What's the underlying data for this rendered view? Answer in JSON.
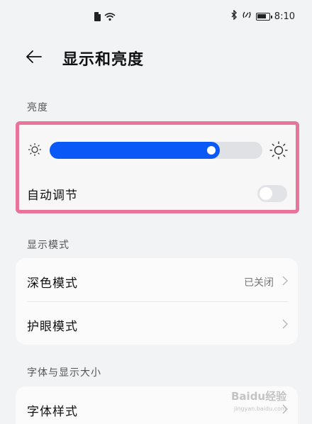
{
  "status_bar": {
    "time": "8:10"
  },
  "header": {
    "title": "显示和亮度"
  },
  "brightness": {
    "section_label": "亮度",
    "level": 0.8,
    "auto_adjust_label": "自动调节",
    "auto_adjust_on": false
  },
  "display_mode": {
    "section_label": "显示模式",
    "items": [
      {
        "label": "深色模式",
        "value": "已关闭"
      },
      {
        "label": "护眼模式",
        "value": ""
      }
    ]
  },
  "font_size": {
    "section_label": "字体与显示大小",
    "items": [
      {
        "label": "字体样式"
      }
    ]
  },
  "watermark": {
    "text": "Baidu经验",
    "sub": "jingyan.baidu.com"
  },
  "colors": {
    "accent": "#0a59f7",
    "highlight": "#e8739b",
    "background": "#f1f3f5"
  }
}
